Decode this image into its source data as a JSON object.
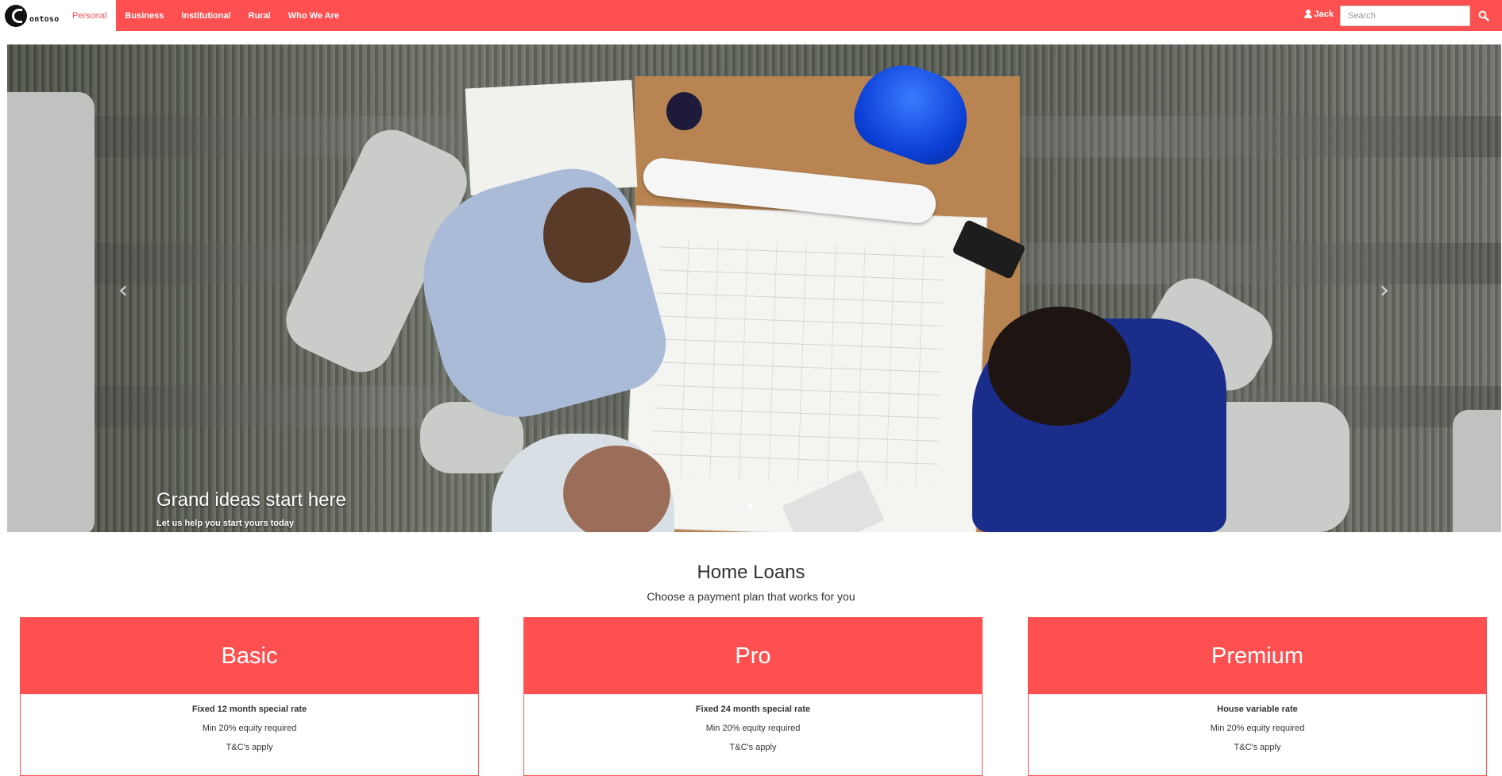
{
  "brand": {
    "logo_text": "ontoso"
  },
  "nav": {
    "items": [
      {
        "label": "Personal",
        "active": true
      },
      {
        "label": "Business",
        "active": false
      },
      {
        "label": "Institutional",
        "active": false
      },
      {
        "label": "Rural",
        "active": false
      },
      {
        "label": "Who We Are",
        "active": false
      }
    ]
  },
  "user": {
    "name": "Jack",
    "icon": "user-icon"
  },
  "search": {
    "placeholder": "Search",
    "value": "",
    "icon": "search-icon"
  },
  "hero": {
    "title": "Grand ideas start here",
    "subtitle": "Let us help you start yours today",
    "prev_icon": "chevron-left-icon",
    "next_icon": "chevron-right-icon",
    "slides": 3,
    "active_slide": 2
  },
  "section": {
    "title": "Home Loans",
    "subtitle": "Choose a payment plan that works for you"
  },
  "plans": [
    {
      "name": "Basic",
      "main": "Fixed 12 month special rate",
      "equity": "Min 20% equity required",
      "terms": "T&C's apply"
    },
    {
      "name": "Pro",
      "main": "Fixed 24 month special rate",
      "equity": "Min 20% equity required",
      "terms": "T&C's apply"
    },
    {
      "name": "Premium",
      "main": "House variable rate",
      "equity": "Min 20% equity required",
      "terms": "T&C's apply"
    }
  ],
  "colors": {
    "accent": "#fe5050",
    "text": "#333333",
    "background": "#ffffff"
  }
}
